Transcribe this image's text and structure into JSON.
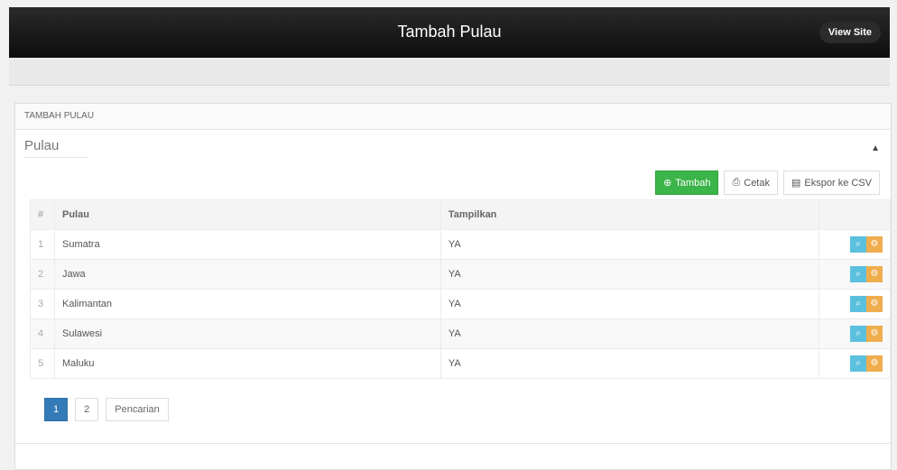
{
  "header": {
    "title": "Tambah Pulau",
    "view_site_label": "View Site"
  },
  "panel": {
    "header_label": "TAMBAH PULAU",
    "section_title": "Pulau",
    "collapse_icon": "chevron-up-icon"
  },
  "toolbar": {
    "tambah_label": "Tambah",
    "cetak_label": "Cetak",
    "export_label": "Ekspor ke CSV"
  },
  "table": {
    "headers": [
      "#",
      "Pulau",
      "Tampilkan",
      ""
    ],
    "rows": [
      {
        "no": "1",
        "pulau": "Sumatra",
        "tampilkan": "YA"
      },
      {
        "no": "2",
        "pulau": "Jawa",
        "tampilkan": "YA"
      },
      {
        "no": "3",
        "pulau": "Kalimantan",
        "tampilkan": "YA"
      },
      {
        "no": "4",
        "pulau": "Sulawesi",
        "tampilkan": "YA"
      },
      {
        "no": "5",
        "pulau": "Maluku",
        "tampilkan": "YA"
      }
    ]
  },
  "pagination": {
    "pages": [
      "1",
      "2"
    ],
    "search_label": "Pencarian"
  },
  "colors": {
    "header_bg": "#111111",
    "add_button": "#3bb449",
    "view_button": "#5bc0de",
    "edit_button": "#f0ad4e",
    "active_page": "#337ab7"
  }
}
